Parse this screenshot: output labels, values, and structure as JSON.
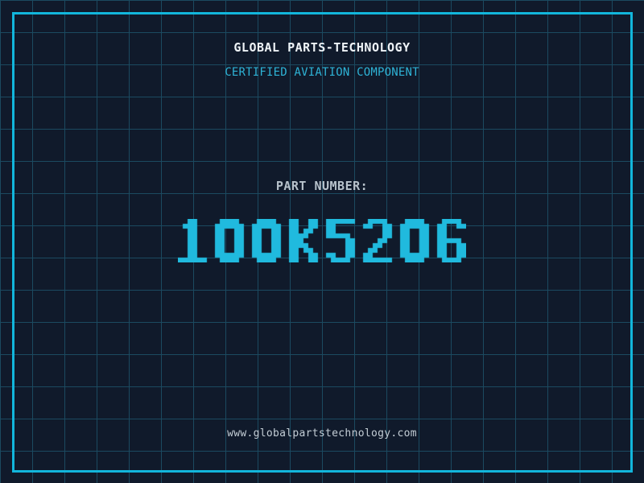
{
  "theme": {
    "background_color": "#101a2b",
    "grid_color": "#1b4a60",
    "frame_color": "#12b6dc",
    "title_color": "#eef3f7",
    "tagline_color": "#2eb3d6",
    "label_color": "#b7c2cb",
    "number_color": "#20bade",
    "url_color": "#c3cdd5"
  },
  "header": {
    "company_name": "GLOBAL PARTS-TECHNOLOGY",
    "tagline": "CERTIFIED AVIATION COMPONENT"
  },
  "part": {
    "label": "PART NUMBER:",
    "number": "100K5206"
  },
  "footer": {
    "website": "www.globalpartstechnology.com"
  }
}
